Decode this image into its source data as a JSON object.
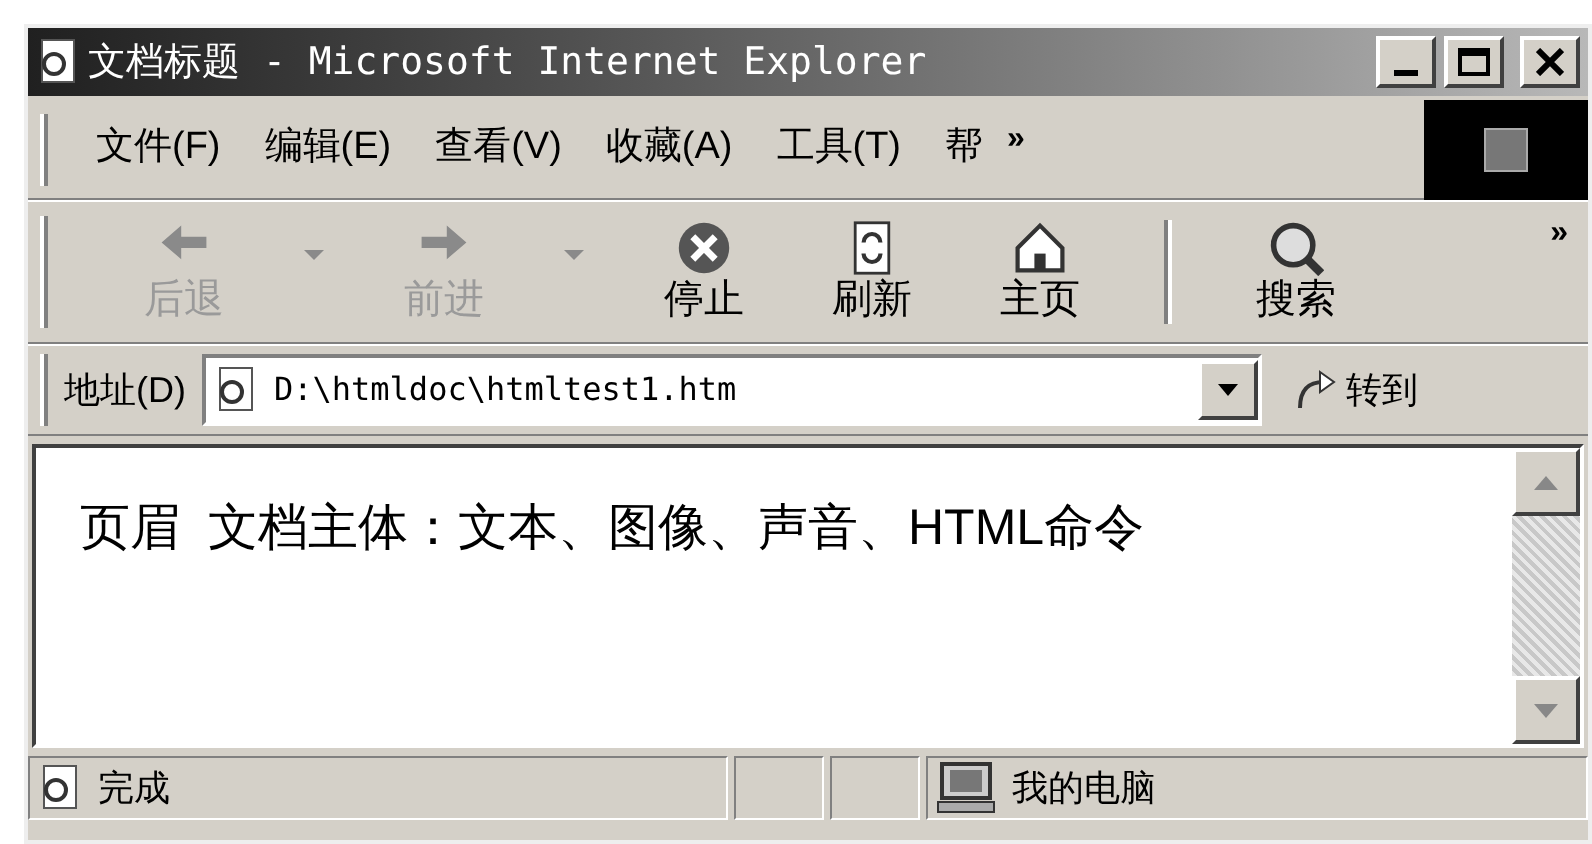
{
  "window": {
    "title": "文档标题 - Microsoft Internet Explorer"
  },
  "menu": [
    {
      "label": "文件(F)"
    },
    {
      "label": "编辑(E)"
    },
    {
      "label": "查看(V)"
    },
    {
      "label": "收藏(A)"
    },
    {
      "label": "工具(T)"
    },
    {
      "label": "帮"
    }
  ],
  "menu_overflow": "»",
  "toolbar": [
    {
      "kind": "back",
      "label": "后退",
      "disabled": true
    },
    {
      "kind": "forward",
      "label": "前进",
      "disabled": true
    },
    {
      "kind": "stop",
      "label": "停止",
      "disabled": false
    },
    {
      "kind": "refresh",
      "label": "刷新",
      "disabled": false
    },
    {
      "kind": "home",
      "label": "主页",
      "disabled": false
    },
    {
      "kind": "search",
      "label": "搜索",
      "disabled": false
    }
  ],
  "toolbar_overflow": "»",
  "address": {
    "label": "地址(D)",
    "value": "D:\\htmldoc\\htmltest1.htm",
    "go": "转到"
  },
  "content": {
    "header": "页眉",
    "body": "文档主体：文本、图像、声音、HTML命令"
  },
  "status_bar": {
    "status": "完成",
    "zone": "我的电脑"
  }
}
